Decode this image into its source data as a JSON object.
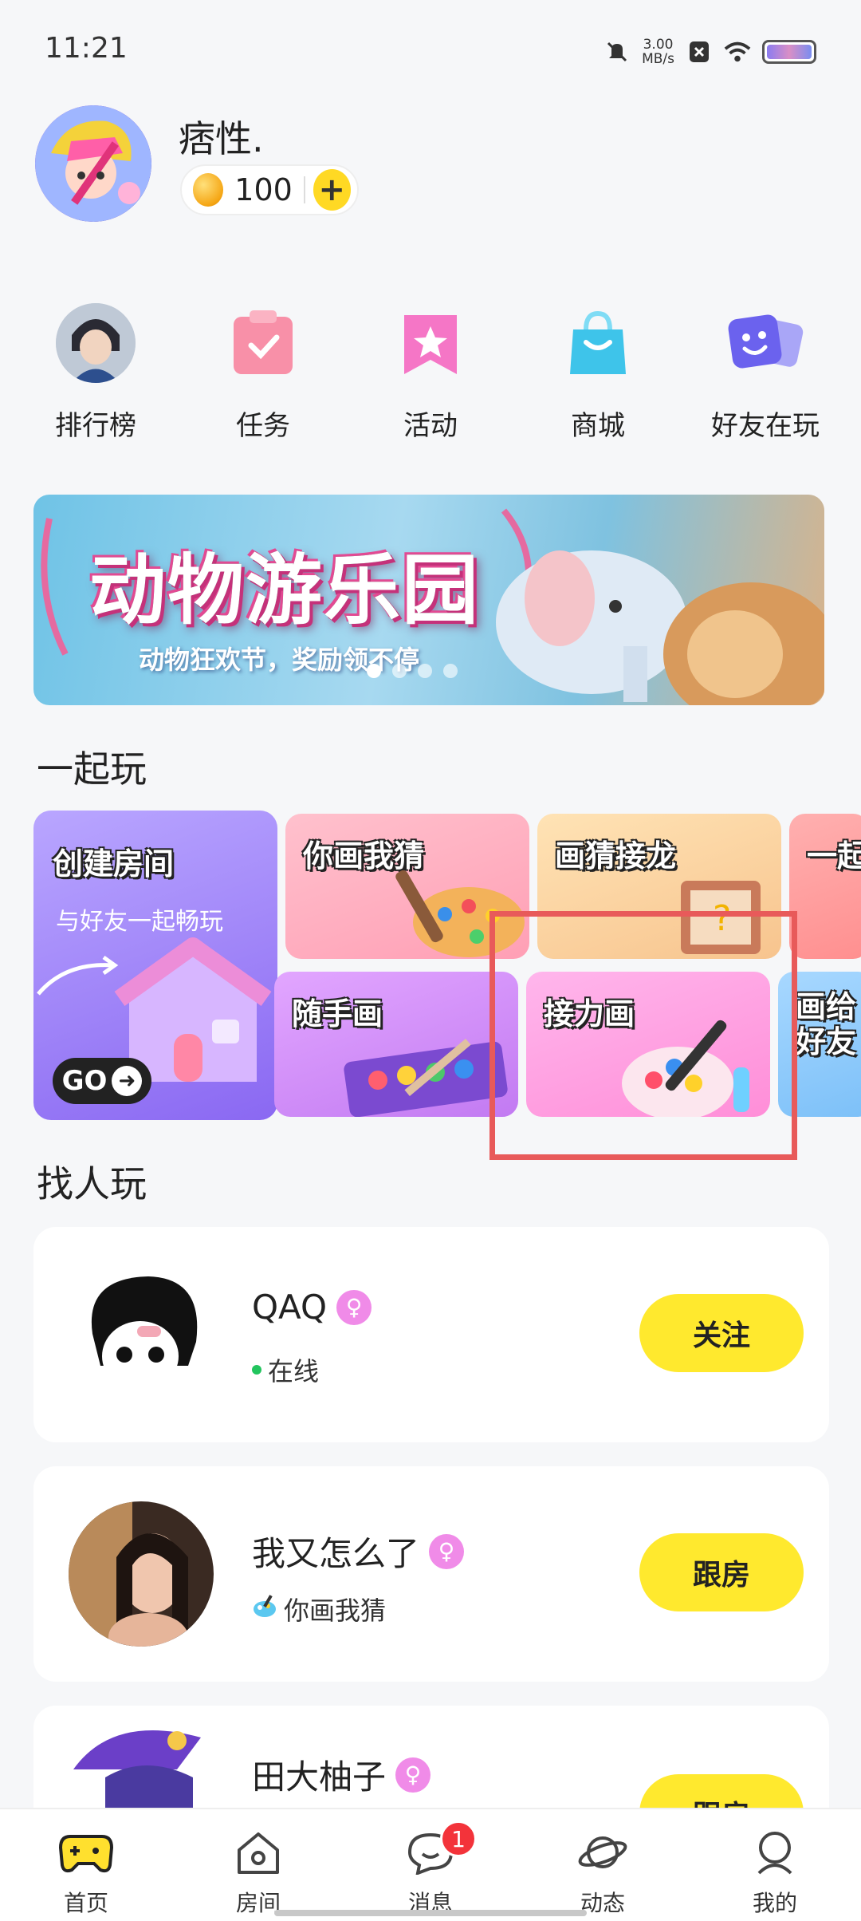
{
  "status_bar": {
    "time": "11:21",
    "net_speed_value": "3.00",
    "net_speed_unit": "MB/s"
  },
  "profile": {
    "username": "痞性.",
    "coins": "100",
    "add_label": "+"
  },
  "quick_menu": [
    {
      "label": "排行榜",
      "icon": "leaderboard-avatar-icon"
    },
    {
      "label": "任务",
      "icon": "task-icon"
    },
    {
      "label": "活动",
      "icon": "activity-icon"
    },
    {
      "label": "商城",
      "icon": "shop-icon"
    },
    {
      "label": "好友在玩",
      "icon": "friends-playing-icon"
    }
  ],
  "banner": {
    "title": "动物游乐园",
    "subtitle": "动物狂欢节，奖励领不停",
    "slide_count": 4,
    "active_slide": 1
  },
  "play_together": {
    "title": "一起玩",
    "create_room": {
      "title": "创建房间",
      "subtitle": "与好友一起畅玩",
      "go_label": "GO"
    },
    "games": [
      {
        "title": "你画我猜"
      },
      {
        "title": "画猜接龙"
      },
      {
        "title": "一起"
      },
      {
        "title": "随手画"
      },
      {
        "title": "接力画"
      },
      {
        "title": "画给好友"
      }
    ]
  },
  "find_people": {
    "title": "找人玩",
    "people": [
      {
        "name": "QAQ",
        "status": "在线",
        "action": "关注"
      },
      {
        "name": "我又怎么了",
        "status": "你画我猜",
        "action": "跟房"
      },
      {
        "name": "田大柚子",
        "status": "",
        "action": "跟房"
      }
    ]
  },
  "bottom_nav": [
    {
      "label": "首页",
      "icon": "gamepad-icon",
      "active": true
    },
    {
      "label": "房间",
      "icon": "house-icon"
    },
    {
      "label": "消息",
      "icon": "chat-bubble-icon",
      "badge": "1"
    },
    {
      "label": "动态",
      "icon": "planet-icon"
    },
    {
      "label": "我的",
      "icon": "profile-icon"
    }
  ],
  "colors": {
    "accent_yellow": "#ffe92e",
    "highlight_red": "#e85a5a",
    "female_pink": "#f08be8"
  }
}
